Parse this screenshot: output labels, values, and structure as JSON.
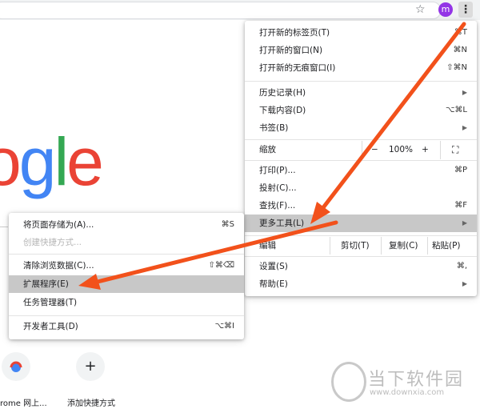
{
  "toolbar": {
    "star_icon": "☆",
    "avatar_letter": "m",
    "menu_icon": "⋮"
  },
  "logo": {
    "letters": [
      "o",
      "g",
      "l",
      "e"
    ],
    "colors": [
      "#ea4335",
      "#4285f4",
      "#34a853",
      "#ea4335"
    ]
  },
  "shortcuts": [
    {
      "label": "rome 网上..."
    },
    {
      "label": "添加快捷方式",
      "icon": "+"
    }
  ],
  "main_menu": {
    "new_tab": {
      "label": "打开新的标签页(T)",
      "shortcut": "⌘T"
    },
    "new_window": {
      "label": "打开新的窗口(N)",
      "shortcut": "⌘N"
    },
    "new_incognito": {
      "label": "打开新的无痕窗口(I)",
      "shortcut": "⇧⌘N"
    },
    "history": {
      "label": "历史记录(H)"
    },
    "downloads": {
      "label": "下载内容(D)",
      "shortcut": "⌥⌘L"
    },
    "bookmarks": {
      "label": "书签(B)"
    },
    "zoom": {
      "label": "缩放",
      "minus": "−",
      "value": "100%",
      "plus": "+",
      "fullscreen_icon": "⛶"
    },
    "print": {
      "label": "打印(P)...",
      "shortcut": "⌘P"
    },
    "cast": {
      "label": "投射(C)..."
    },
    "find": {
      "label": "查找(F)...",
      "shortcut": "⌘F"
    },
    "more_tools": {
      "label": "更多工具(L)"
    },
    "edit": {
      "label": "编辑",
      "cut": "剪切(T)",
      "copy": "复制(C)",
      "paste": "粘贴(P)"
    },
    "settings": {
      "label": "设置(S)",
      "shortcut": "⌘,"
    },
    "help": {
      "label": "帮助(E)"
    }
  },
  "submenu": {
    "save_page": {
      "label": "将页面存储为(A)...",
      "shortcut": "⌘S"
    },
    "create_shortcut": {
      "label": "创建快捷方式..."
    },
    "clear_data": {
      "label": "清除浏览数据(C)...",
      "shortcut": "⇧⌘⌫"
    },
    "extensions": {
      "label": "扩展程序(E)"
    },
    "task_manager": {
      "label": "任务管理器(T)"
    },
    "dev_tools": {
      "label": "开发者工具(D)",
      "shortcut": "⌥⌘I"
    }
  },
  "watermark": {
    "text": "当下软件园",
    "url": "www.downxia.com"
  },
  "colors": {
    "arrow": "#f2511b",
    "highlight": "#c8c8c8"
  }
}
